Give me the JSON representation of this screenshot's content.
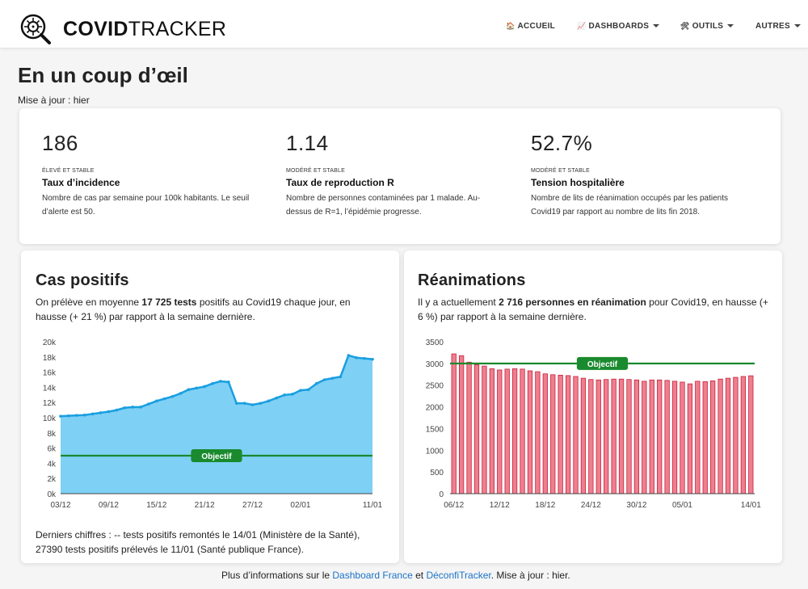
{
  "brand": {
    "bold": "COVID",
    "light": "TRACKER"
  },
  "nav": {
    "home": {
      "icon": "house-icon",
      "label": "ACCUEIL"
    },
    "dashboards": {
      "icon": "chart-icon",
      "label": "DASHBOARDS"
    },
    "tools": {
      "icon": "tools-icon",
      "label": "OUTILS"
    },
    "others": {
      "label": "AUTRES"
    }
  },
  "page": {
    "title": "En un coup d’œil",
    "updated": "Mise à jour : hier"
  },
  "stats": [
    {
      "value": "186",
      "level": "ÉLEVÉ ET STABLE",
      "label": "Taux d’incidence",
      "desc": "Nombre de cas par semaine pour 100k habitants. Le seuil d’alerte est 50."
    },
    {
      "value": "1.14",
      "level": "MODÉRÉ ET STABLE",
      "label": "Taux de reproduction R",
      "desc": "Nombre de personnes contaminées par 1 malade. Au-dessus de R=1, l’épidémie progresse."
    },
    {
      "value": "52.7%",
      "level": "MODÉRÉ ET STABLE",
      "label": "Tension hospitalière",
      "desc": "Nombre de lits de réanimation occupés par les patients Covid19 par rapport au nombre de lits fin 2018."
    }
  ],
  "cases": {
    "title": "Cas positifs",
    "text_pre": "On prélève en moyenne ",
    "text_bold": "17 725 tests",
    "text_post": " positifs au Covid19 chaque jour, en hausse (+ 21 %) par rapport à la semaine dernière.",
    "footer_line1": "Derniers chiffres : -- tests positifs remontés le 14/01 (Ministère de la Santé),",
    "footer_line2": "27390 tests positifs prélevés le 11/01 (Santé publique France)."
  },
  "icu": {
    "title": "Réanimations",
    "text_pre": "Il y a actuellement ",
    "text_bold": "2 716 personnes en réanimation",
    "text_post": " pour Covid19, en hausse (+ 6 %) par rapport à la semaine dernière."
  },
  "footer": {
    "pre": "Plus d’informations sur le ",
    "link1": "Dashboard France",
    "mid": " et ",
    "link2": "DéconfiTracker",
    "post": ". Mise à jour : hier."
  },
  "colors": {
    "cases_fill": "#7fd0f5",
    "cases_line": "#1a9fe0",
    "icu_bar": "#ee7f8e",
    "icu_bar_stroke": "#c81f3a",
    "objective": "#1a8a2e",
    "link": "#1a73c8"
  },
  "chart_data": [
    {
      "type": "area",
      "x": [
        "03/12",
        "04/12",
        "05/12",
        "06/12",
        "07/12",
        "08/12",
        "09/12",
        "10/12",
        "11/12",
        "12/12",
        "13/12",
        "14/12",
        "15/12",
        "16/12",
        "17/12",
        "18/12",
        "19/12",
        "20/12",
        "21/12",
        "22/12",
        "23/12",
        "24/12",
        "25/12",
        "26/12",
        "27/12",
        "28/12",
        "29/12",
        "30/12",
        "31/12",
        "01/01",
        "02/01",
        "03/01",
        "04/01",
        "05/01",
        "06/01",
        "07/01",
        "08/01",
        "09/01",
        "10/01",
        "11/01"
      ],
      "values": [
        10200,
        10250,
        10300,
        10350,
        10500,
        10650,
        10800,
        11000,
        11300,
        11400,
        11400,
        11800,
        12200,
        12500,
        12800,
        13200,
        13700,
        13900,
        14100,
        14500,
        14800,
        14700,
        11900,
        11900,
        11700,
        11900,
        12200,
        12600,
        13000,
        13100,
        13600,
        13700,
        14500,
        15000,
        15200,
        15400,
        18200,
        17900,
        17800,
        17700
      ],
      "x_ticks": [
        "03/12",
        "09/12",
        "15/12",
        "21/12",
        "27/12",
        "02/01",
        "11/01"
      ],
      "y_ticks": [
        "0k",
        "2k",
        "4k",
        "6k",
        "8k",
        "10k",
        "12k",
        "14k",
        "16k",
        "18k",
        "20k"
      ],
      "ylim": [
        0,
        20000
      ],
      "objective": {
        "label": "Objectif",
        "value": 5000
      }
    },
    {
      "type": "bar",
      "x": [
        "06/12",
        "07/12",
        "08/12",
        "09/12",
        "10/12",
        "11/12",
        "12/12",
        "13/12",
        "14/12",
        "15/12",
        "16/12",
        "17/12",
        "18/12",
        "19/12",
        "20/12",
        "21/12",
        "22/12",
        "23/12",
        "24/12",
        "25/12",
        "26/12",
        "27/12",
        "28/12",
        "29/12",
        "30/12",
        "31/12",
        "01/01",
        "02/01",
        "03/01",
        "04/01",
        "05/01",
        "06/01",
        "07/01",
        "08/01",
        "09/01",
        "10/01",
        "11/01",
        "12/01",
        "13/01",
        "14/01"
      ],
      "values": [
        3220,
        3180,
        3030,
        2970,
        2940,
        2880,
        2850,
        2870,
        2880,
        2870,
        2830,
        2810,
        2760,
        2740,
        2730,
        2720,
        2700,
        2660,
        2630,
        2620,
        2630,
        2640,
        2640,
        2630,
        2620,
        2590,
        2620,
        2620,
        2610,
        2590,
        2570,
        2530,
        2590,
        2580,
        2600,
        2640,
        2660,
        2680,
        2700,
        2716
      ],
      "x_ticks": [
        "06/12",
        "12/12",
        "18/12",
        "24/12",
        "30/12",
        "05/01",
        "14/01"
      ],
      "y_ticks": [
        "0",
        "500",
        "1000",
        "1500",
        "2000",
        "2500",
        "3000",
        "3500"
      ],
      "ylim": [
        0,
        3500
      ],
      "objective": {
        "label": "Objectif",
        "value": 3000
      }
    }
  ]
}
